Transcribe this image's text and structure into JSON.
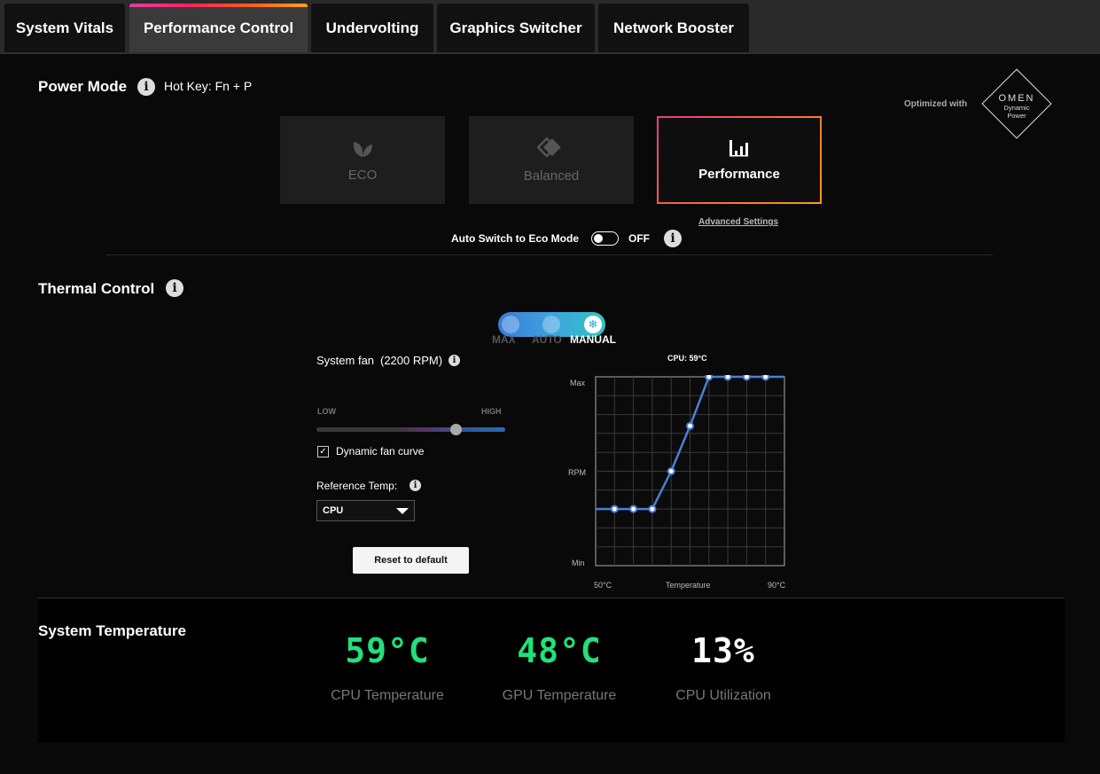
{
  "tabs": [
    {
      "label": "System Vitals",
      "active": false
    },
    {
      "label": "Performance Control",
      "active": true
    },
    {
      "label": "Undervolting",
      "active": false
    },
    {
      "label": "Graphics Switcher",
      "active": false
    },
    {
      "label": "Network Booster",
      "active": false
    }
  ],
  "power_mode": {
    "title": "Power Mode",
    "hotkey": "Hot Key: Fn + P",
    "optimized_with": "Optimized with",
    "omen_logo": {
      "brand": "OMEN",
      "line1": "Dynamic",
      "line2": "Power"
    },
    "modes": [
      {
        "label": "ECO",
        "icon": "leaf-icon",
        "active": false
      },
      {
        "label": "Balanced",
        "icon": "balanced-icon",
        "active": false
      },
      {
        "label": "Performance",
        "icon": "performance-bars-icon",
        "active": true
      }
    ],
    "advanced_settings": "Advanced Settings",
    "auto_switch_label": "Auto Switch to Eco Mode",
    "auto_switch_state": "OFF"
  },
  "thermal": {
    "title": "Thermal Control",
    "fan_modes": [
      "MAX",
      "AUTO",
      "MANUAL"
    ],
    "selected_fan_mode": "MANUAL",
    "system_fan_label": "System fan",
    "system_fan_rpm": "(2200 RPM)",
    "slider_low": "LOW",
    "slider_high": "HIGH",
    "slider_value": 0.74,
    "dynamic_curve_label": "Dynamic fan curve",
    "dynamic_curve_checked": true,
    "reference_temp_label": "Reference Temp:",
    "reference_temp_value": "CPU",
    "reset_label": "Reset to default"
  },
  "chart_data": {
    "type": "line",
    "title": "CPU: 59°C",
    "xlabel": "Temperature",
    "ylabel": "RPM",
    "x_tick_labels": [
      "50°C",
      "90°C"
    ],
    "y_tick_labels": [
      "Min",
      "Max"
    ],
    "grid": true,
    "x_grid_divisions": 10,
    "y_grid_divisions": 10,
    "series": [
      {
        "x": [
          0,
          1,
          2,
          3,
          4,
          5,
          6,
          7,
          8,
          9,
          10
        ],
        "y": [
          0.3,
          0.3,
          0.3,
          0.3,
          0.5,
          0.74,
          1.0,
          1.0,
          1.0,
          1.0,
          1.0
        ],
        "markers": [
          false,
          true,
          true,
          true,
          true,
          true,
          true,
          true,
          true,
          true,
          false
        ],
        "color": "#4a7fd8"
      }
    ],
    "xlim": [
      0,
      10
    ],
    "ylim": [
      0,
      1
    ]
  },
  "system_temperature": {
    "title": "System Temperature",
    "metrics": [
      {
        "value": "59°C",
        "label": "CPU Temperature",
        "color": "#22e07a"
      },
      {
        "value": "48°C",
        "label": "GPU Temperature",
        "color": "#22e07a"
      },
      {
        "value": "13%",
        "label": "CPU Utilization",
        "color": "#ffffff"
      }
    ]
  }
}
